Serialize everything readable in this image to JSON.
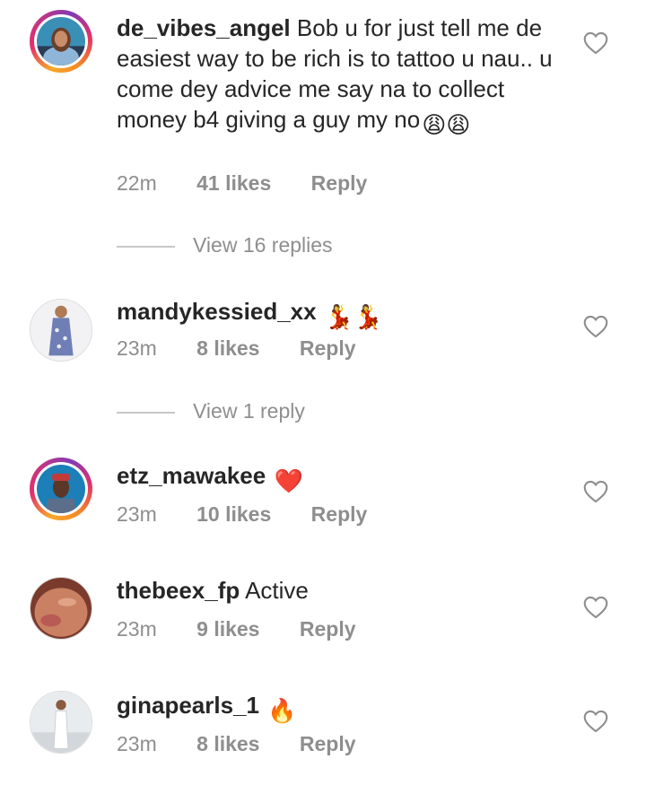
{
  "comments": [
    {
      "username": "de_vibes_angel",
      "text": "Bob u for just tell me de easiest way to be rich is to tattoo u nau.. u come dey advice me say na to collect money b4 giving a guy my no",
      "emoji": "😩😩",
      "time": "22m",
      "likes": "41 likes",
      "reply": "Reply",
      "view_replies": "View 16 replies",
      "avatar": "woman-avatar-photo",
      "story_ring": true
    },
    {
      "username": "mandykessied_xx",
      "text": "",
      "emoji": "💃💃",
      "time": "23m",
      "likes": "8 likes",
      "reply": "Reply",
      "view_replies": "View 1 reply",
      "avatar": "woman-in-dress-photo",
      "story_ring": false
    },
    {
      "username": "etz_mawakee",
      "text": "",
      "emoji": "❤️",
      "time": "23m",
      "likes": "10 likes",
      "reply": "Reply",
      "avatar": "man-with-cap-photo",
      "story_ring": true
    },
    {
      "username": "thebeex_fp",
      "text": "Active",
      "emoji": "",
      "time": "23m",
      "likes": "9 likes",
      "reply": "Reply",
      "avatar": "face-closeup-photo",
      "story_ring": false
    },
    {
      "username": "ginapearls_1",
      "text": "",
      "emoji": "🔥",
      "time": "23m",
      "likes": "8 likes",
      "reply": "Reply",
      "avatar": "woman-standing-photo",
      "story_ring": false
    }
  ],
  "icons": {
    "like": "heart-outline-icon"
  },
  "colors": {
    "text": "#262626",
    "muted": "#8e8e8e",
    "divider": "#c7c7c7"
  }
}
